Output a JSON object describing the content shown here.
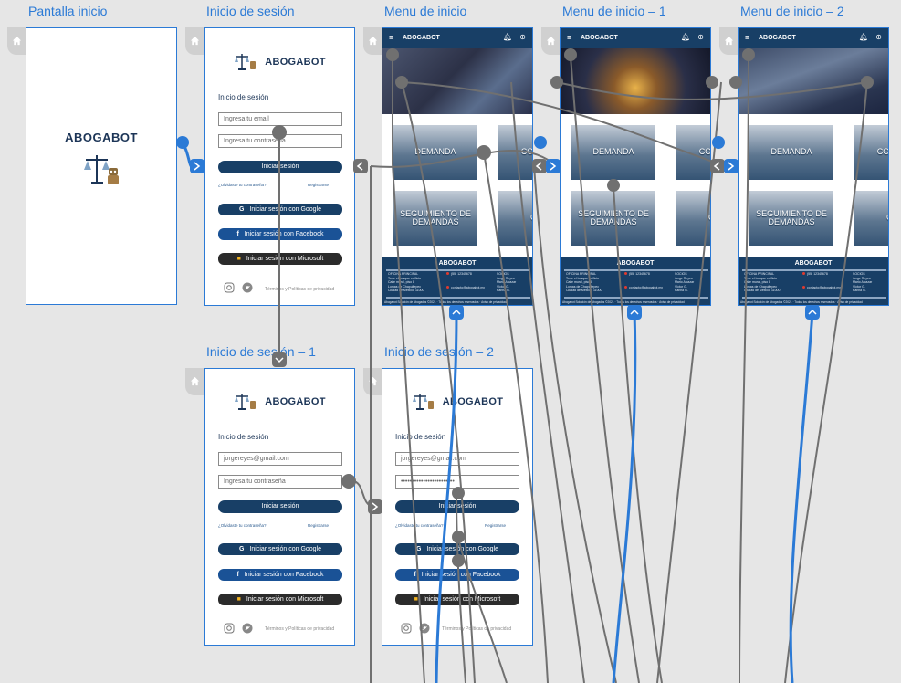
{
  "artboards": {
    "pantalla": "Pantalla inicio",
    "sesion": "Inicio de sesión",
    "menu": "Menu de inicio",
    "menu1": "Menu de inicio – 1",
    "menu2": "Menu de inicio – 2",
    "sesion1": "Inicio de sesión – 1",
    "sesion2": "Inicio de sesión – 2"
  },
  "brand": "ABOGABOT",
  "login": {
    "heading": "Inicio de sesión",
    "email_placeholder": "Ingresa tu email",
    "password_placeholder": "Ingresa tu contraseña",
    "email_value": "jorgereyes@gmail.com",
    "password_masked": "••••••••••••••••••••••••",
    "button": "Iniciar sesión",
    "forgot": "¿Olvidaste tu contraseña?",
    "register": "Registrarse",
    "google": "Iniciar sesión con Google",
    "facebook": "Iniciar sesión con Facebook",
    "microsoft": "Iniciar sesión con Microsoft",
    "terms": "Términos y Políticas de privacidad"
  },
  "menu": {
    "title": "ABOGABOT",
    "tile1": "DEMANDA",
    "tile2": "CON LEG",
    "tile3": "SEGUIMIENTO DE DEMANDAS",
    "tile4": "CON",
    "footer_title": "ABOGABOT",
    "office_label": "OFICINA PRINCIPAL",
    "office_lines": [
      "Torre el bosque edificio",
      "Calle mural, piso 8",
      "Lomas de Chapultepec",
      "Ciudad de México, 11000"
    ],
    "phone": "(55) 12345678",
    "email": "contacto@abogabot.mx",
    "partners_label": "SOCIOS",
    "partners": [
      "Jorge Reyes",
      "Mario Alcazar",
      "Víctor G.",
      "Karina G."
    ],
    "copyright": "Abogabot Solución de Abogados ©2021 · Todos los derechos reservados · Aviso de privacidad"
  },
  "colors": {
    "brand_navy": "#183f66",
    "link_blue": "#2b7ad6",
    "flow_gray": "#707070",
    "google_btn": "#183f66",
    "facebook_btn": "#1a5296",
    "microsoft_btn": "#2b2b2b"
  }
}
